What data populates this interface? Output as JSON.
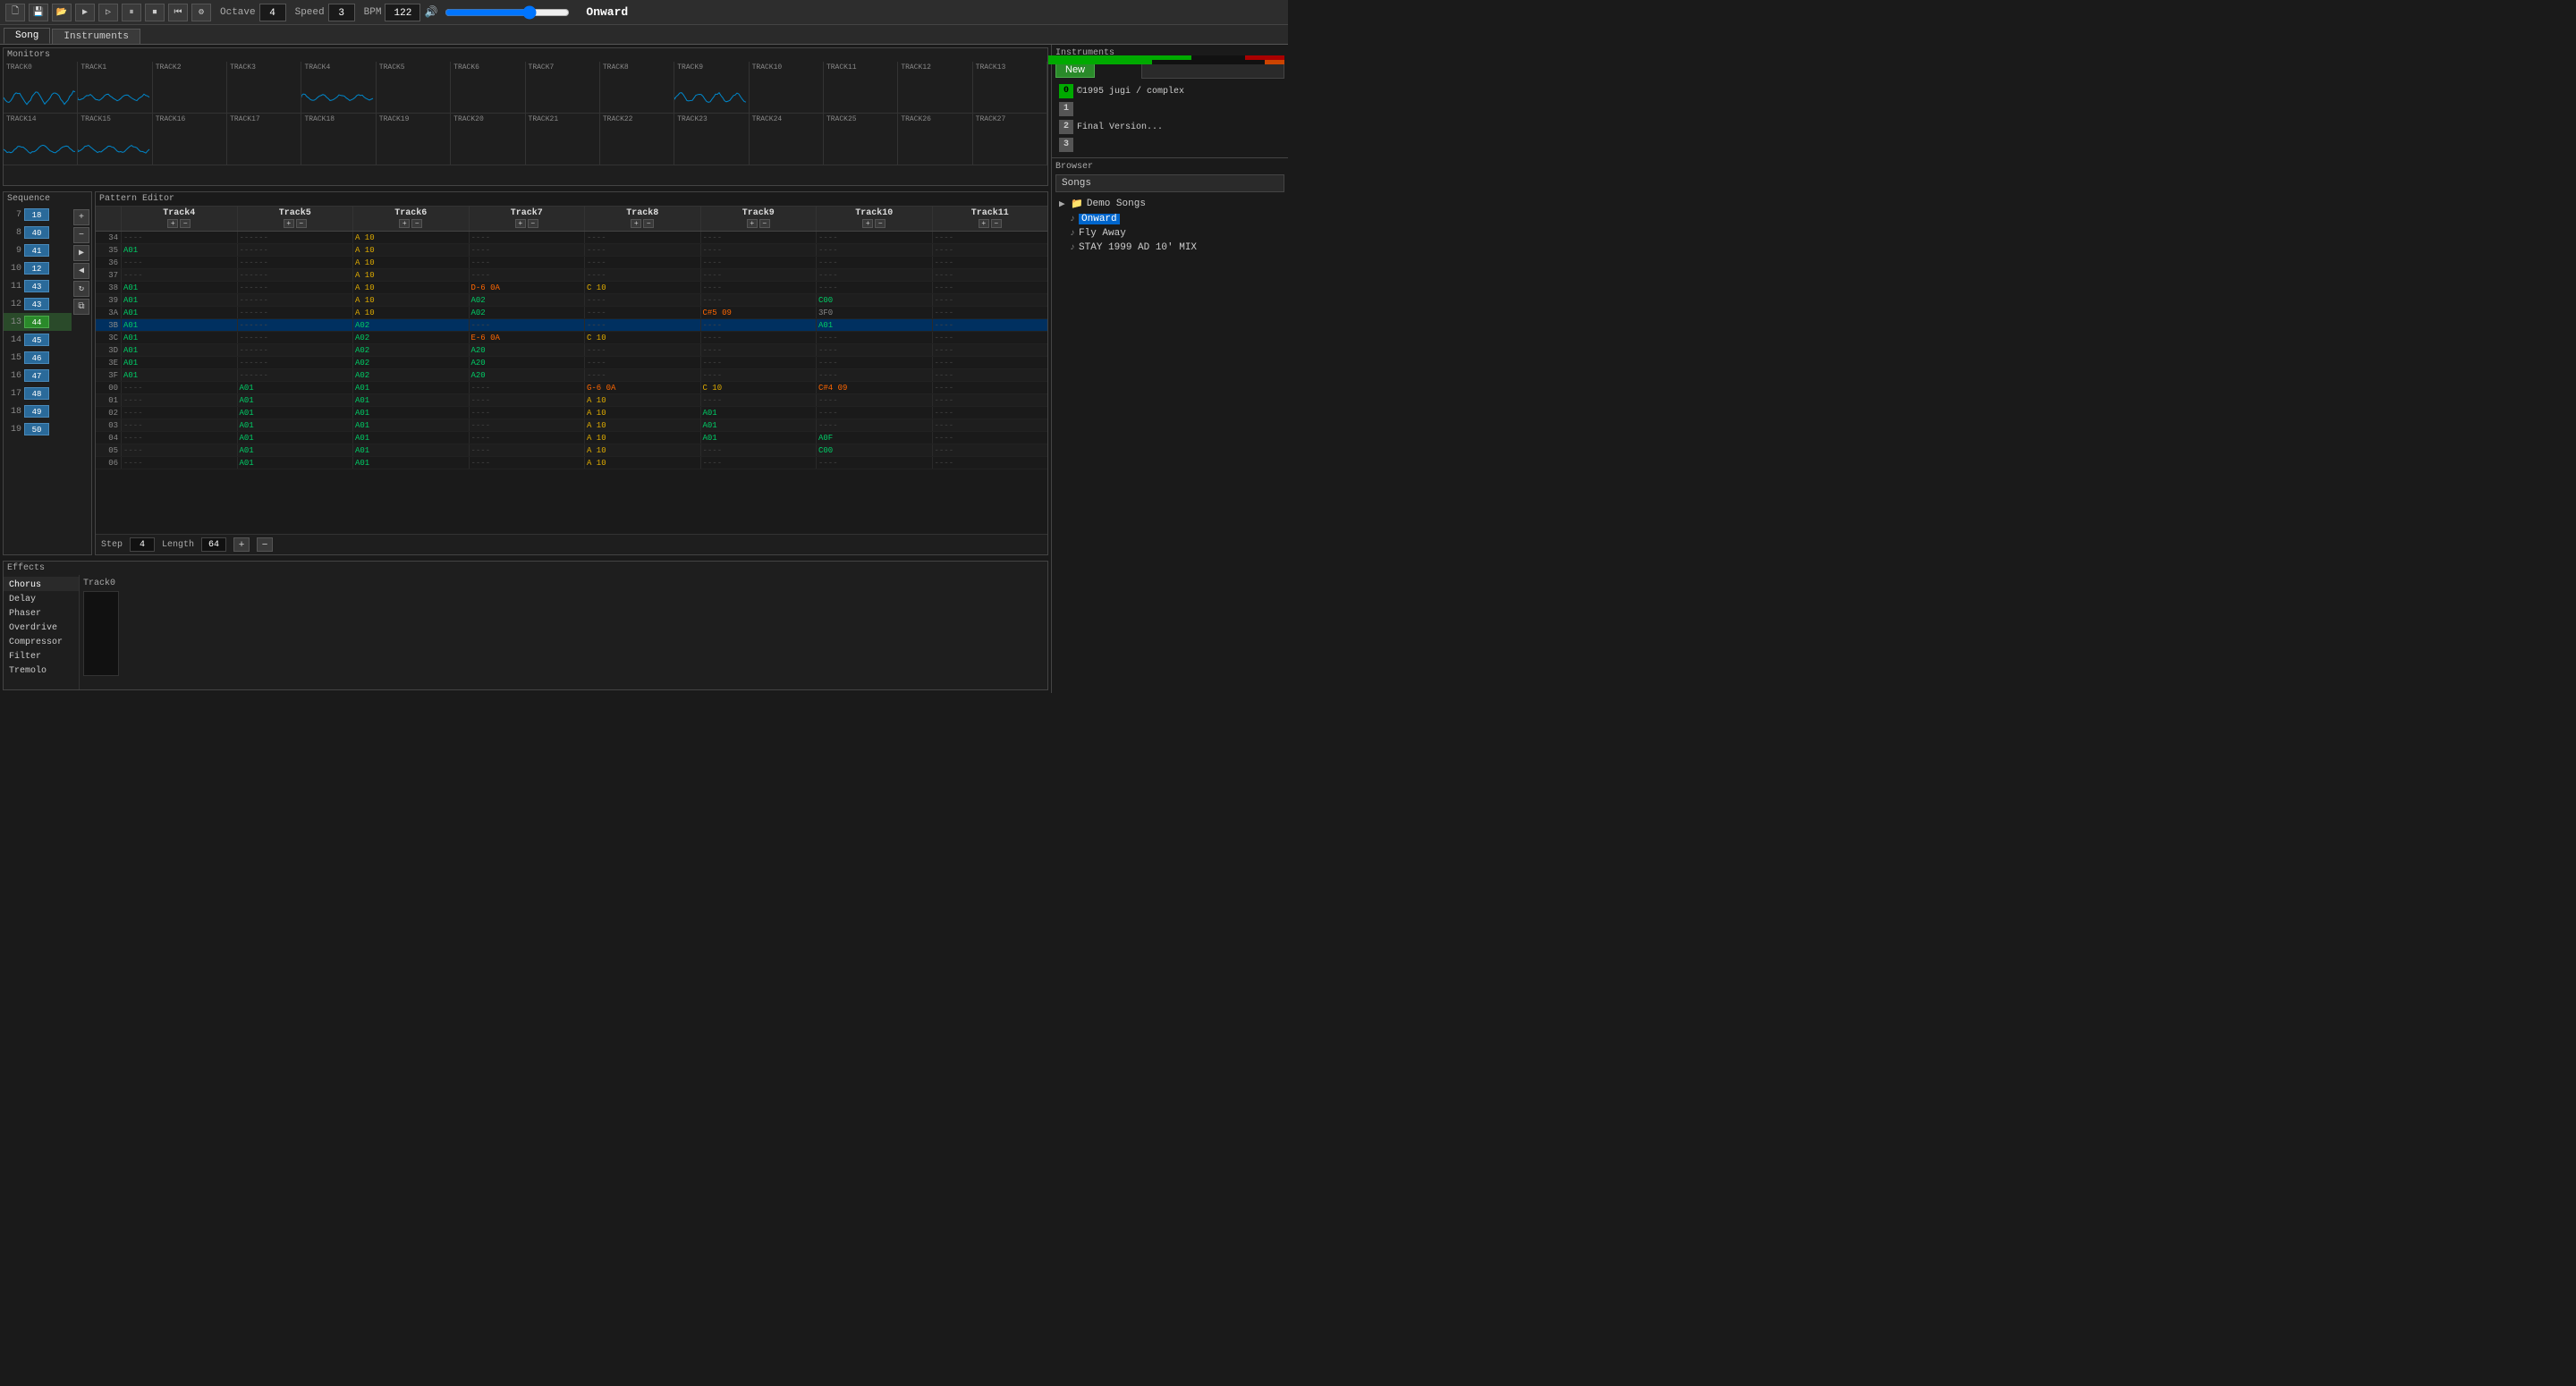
{
  "toolbar": {
    "octave_label": "Octave",
    "octave_value": "4",
    "speed_label": "Speed",
    "speed_value": "3",
    "bpm_label": "BPM",
    "bpm_value": "122",
    "song_name": "Onward",
    "new_button": "New"
  },
  "tabs": {
    "song": "Song",
    "instruments": "Instruments"
  },
  "monitors": {
    "label": "Monitors",
    "row1": [
      "TRACK0",
      "TRACK1",
      "TRACK2",
      "TRACK3",
      "TRACK4",
      "TRACK5",
      "TRACK6",
      "TRACK7",
      "TRACK8",
      "TRACK9",
      "TRACK10",
      "TRACK11",
      "TRACK12",
      "TRACK13"
    ],
    "row2": [
      "TRACK14",
      "TRACK15",
      "TRACK16",
      "TRACK17",
      "TRACK18",
      "TRACK19",
      "TRACK20",
      "TRACK21",
      "TRACK22",
      "TRACK23",
      "TRACK24",
      "TRACK25",
      "TRACK26",
      "TRACK27"
    ]
  },
  "sequence": {
    "label": "Sequence",
    "rows": [
      {
        "num": "7",
        "val": "18",
        "active": false
      },
      {
        "num": "8",
        "val": "40",
        "active": false
      },
      {
        "num": "9",
        "val": "41",
        "active": false
      },
      {
        "num": "10",
        "val": "12",
        "active": false
      },
      {
        "num": "11",
        "val": "43",
        "active": false
      },
      {
        "num": "12",
        "val": "43",
        "active": false
      },
      {
        "num": "13",
        "val": "44",
        "active": true
      },
      {
        "num": "14",
        "val": "45",
        "active": false
      },
      {
        "num": "15",
        "val": "46",
        "active": false
      },
      {
        "num": "16",
        "val": "47",
        "active": false
      },
      {
        "num": "17",
        "val": "48",
        "active": false
      },
      {
        "num": "18",
        "val": "49",
        "active": false
      },
      {
        "num": "19",
        "val": "50",
        "active": false
      }
    ]
  },
  "pattern_editor": {
    "label": "Pattern Editor",
    "tracks": [
      "Track4",
      "Track5",
      "Track6",
      "Track7",
      "Track8",
      "Track9",
      "Track10",
      "Track11"
    ],
    "step_label": "Step",
    "step_value": "4",
    "length_label": "Length",
    "length_value": "64",
    "rows": [
      {
        "num": "34",
        "cells": [
          "----",
          "------",
          "A 10",
          "----",
          "----",
          "----",
          "----",
          "----"
        ]
      },
      {
        "num": "35",
        "cells": [
          "A01",
          "------",
          "A 10",
          "----",
          "----",
          "----",
          "----",
          "----"
        ]
      },
      {
        "num": "36",
        "cells": [
          "----",
          "------",
          "A 10",
          "----",
          "----",
          "----",
          "----",
          "----"
        ]
      },
      {
        "num": "37",
        "cells": [
          "----",
          "------",
          "A 10",
          "----",
          "----",
          "----",
          "----",
          "----"
        ]
      },
      {
        "num": "38",
        "cells": [
          "A01",
          "------",
          "A 10",
          "D-6 0A",
          "C 10",
          "----",
          "----",
          "----"
        ]
      },
      {
        "num": "39",
        "cells": [
          "A01",
          "------",
          "A 10",
          "A02",
          "----",
          "----",
          "C00",
          "----"
        ]
      },
      {
        "num": "3A",
        "cells": [
          "A01",
          "------",
          "A 10",
          "A02",
          "----",
          "C#5 09",
          "3F0",
          "----"
        ]
      },
      {
        "num": "3B",
        "cells": [
          "A01",
          "------",
          "A02",
          "----",
          "----",
          "----",
          "A01",
          "----"
        ],
        "highlight": true
      },
      {
        "num": "3C",
        "cells": [
          "A01",
          "------",
          "A02",
          "E-6 0A",
          "C 10",
          "----",
          "----",
          "----"
        ]
      },
      {
        "num": "3D",
        "cells": [
          "A01",
          "------",
          "A02",
          "A20",
          "----",
          "----",
          "----",
          "----"
        ]
      },
      {
        "num": "3E",
        "cells": [
          "A01",
          "------",
          "A02",
          "A20",
          "----",
          "----",
          "----",
          "----"
        ]
      },
      {
        "num": "3F",
        "cells": [
          "A01",
          "------",
          "A02",
          "A20",
          "----",
          "----",
          "----",
          "----"
        ]
      },
      {
        "num": "00",
        "cells": [
          "----",
          "A01",
          "A01",
          "----",
          "G-6 0A",
          "C 10",
          "C#4 09",
          "----"
        ]
      },
      {
        "num": "01",
        "cells": [
          "----",
          "A01",
          "A01",
          "----",
          "A 10",
          "----",
          "----",
          "----"
        ]
      },
      {
        "num": "02",
        "cells": [
          "----",
          "A01",
          "A01",
          "----",
          "A 10",
          "A01",
          "----",
          "----"
        ]
      },
      {
        "num": "03",
        "cells": [
          "----",
          "A01",
          "A01",
          "----",
          "A 10",
          "A01",
          "----",
          "----"
        ]
      },
      {
        "num": "04",
        "cells": [
          "----",
          "A01",
          "A01",
          "----",
          "A 10",
          "A01",
          "A0F",
          "----"
        ]
      },
      {
        "num": "05",
        "cells": [
          "----",
          "A01",
          "A01",
          "----",
          "A 10",
          "----",
          "C00",
          "----"
        ]
      },
      {
        "num": "06",
        "cells": [
          "----",
          "A01",
          "A01",
          "----",
          "A 10",
          "----",
          "----",
          "----"
        ]
      }
    ]
  },
  "effects": {
    "label": "Effects",
    "items": [
      "Chorus",
      "Delay",
      "Phaser",
      "Overdrive",
      "Compressor",
      "Filter",
      "Tremolo"
    ],
    "track_label": "Track0"
  },
  "instruments": {
    "label": "Instruments",
    "new_btn": "New",
    "song_info": [
      {
        "num": "0",
        "num_style": "green",
        "text": "©1995 jugi / complex"
      },
      {
        "num": "1",
        "num_style": "gray",
        "text": ""
      },
      {
        "num": "2",
        "num_style": "gray",
        "text": "Final Version..."
      },
      {
        "num": "3",
        "num_style": "gray",
        "text": ""
      }
    ]
  },
  "browser": {
    "label": "Browser",
    "songs_label": "Songs",
    "folder": "Demo Songs",
    "songs": [
      "Onward",
      "Fly Away",
      "STAY 1999 AD 10' MIX"
    ],
    "active_song": "Onward"
  }
}
